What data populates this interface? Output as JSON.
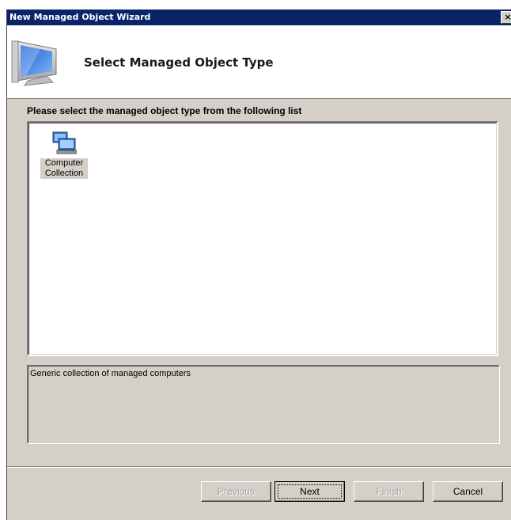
{
  "window": {
    "title": "New Managed Object Wizard",
    "close_glyph": "×"
  },
  "header": {
    "title": "Select Managed Object Type",
    "icon": "monitor-icon"
  },
  "prompt": "Please select the managed object type from the following list",
  "list": {
    "items": [
      {
        "label": "Computer Collection",
        "icon": "computer-collection-icon",
        "selected": true
      }
    ]
  },
  "description": "Generic collection of managed computers",
  "buttons": {
    "previous": {
      "label": "Previous",
      "enabled": false
    },
    "next": {
      "label": "Next",
      "enabled": true,
      "default": true
    },
    "finish": {
      "label": "Finish",
      "enabled": false
    },
    "cancel": {
      "label": "Cancel",
      "enabled": true
    }
  },
  "colors": {
    "titlebar": "#0a246a",
    "dialog": "#d4d0c8",
    "disabled_text": "#a0a0a0"
  }
}
